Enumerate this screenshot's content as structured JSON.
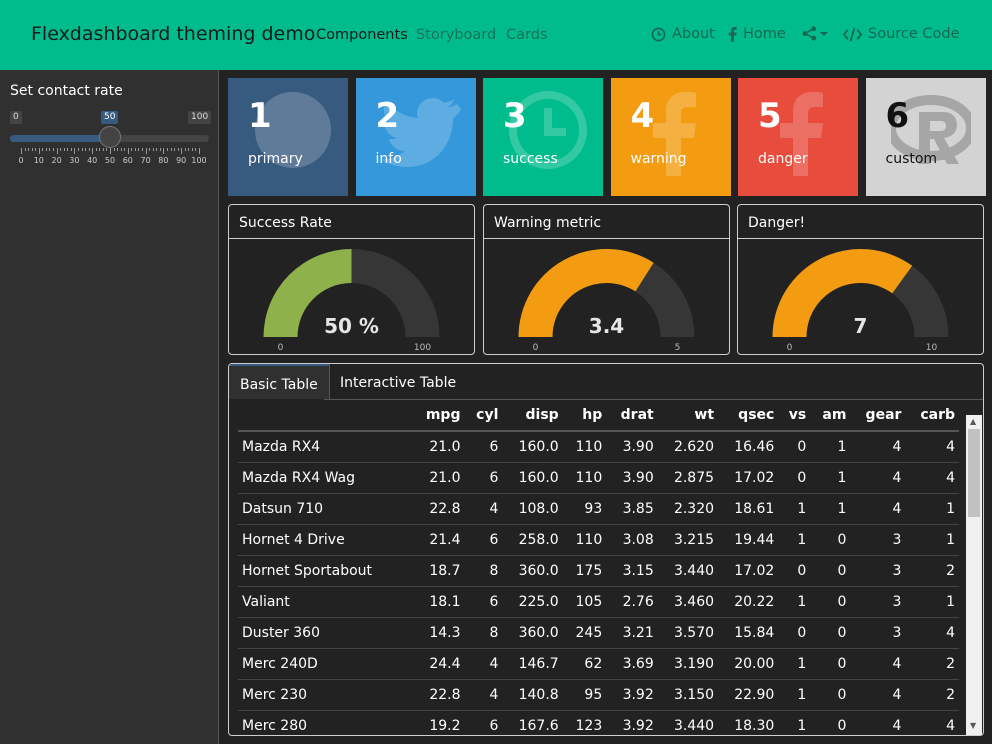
{
  "navbar": {
    "brand": "Flexdashboard theming demo",
    "links": [
      "Components",
      "Storyboard",
      "Cards"
    ],
    "right": {
      "about": "About",
      "home": "Home",
      "source": "Source Code"
    },
    "bg_color": "#00bc8c"
  },
  "sidebar": {
    "label": "Set contact rate",
    "slider": {
      "min": "0",
      "max": "100",
      "value": "50",
      "ticks": [
        "0",
        "10",
        "20",
        "30",
        "40",
        "50",
        "60",
        "70",
        "80",
        "90",
        "100"
      ]
    }
  },
  "value_boxes": [
    {
      "value": "1",
      "caption": "primary",
      "color": "#375a7f",
      "icon": "github-icon"
    },
    {
      "value": "2",
      "caption": "info",
      "color": "#3498db",
      "icon": "twitter-icon"
    },
    {
      "value": "3",
      "caption": "success",
      "color": "#00bc8c",
      "icon": "clock-icon"
    },
    {
      "value": "4",
      "caption": "warning",
      "color": "#f39c12",
      "icon": "facebook-icon"
    },
    {
      "value": "5",
      "caption": "danger",
      "color": "#e74c3c",
      "icon": "facebook-icon"
    },
    {
      "value": "6",
      "caption": "custom",
      "color": "#d3d3d3",
      "icon": "r-logo-icon"
    }
  ],
  "gauges": [
    {
      "title": "Success Rate",
      "value": 50,
      "min": 0,
      "max": 100,
      "display": "50 %",
      "min_label": "0",
      "max_label": "100",
      "color": "#8fb14b"
    },
    {
      "title": "Warning metric",
      "value": 3.4,
      "min": 0,
      "max": 5,
      "display": "3.4",
      "min_label": "0",
      "max_label": "5",
      "color": "#f39c12"
    },
    {
      "title": "Danger!",
      "value": 7,
      "min": 0,
      "max": 10,
      "display": "7",
      "min_label": "0",
      "max_label": "10",
      "color": "#f39c12"
    }
  ],
  "tabs": [
    "Basic Table",
    "Interactive Table"
  ],
  "table": {
    "columns": [
      "",
      "mpg",
      "cyl",
      "disp",
      "hp",
      "drat",
      "wt",
      "qsec",
      "vs",
      "am",
      "gear",
      "carb"
    ],
    "rows": [
      [
        "Mazda RX4",
        "21.0",
        "6",
        "160.0",
        "110",
        "3.90",
        "2.620",
        "16.46",
        "0",
        "1",
        "4",
        "4"
      ],
      [
        "Mazda RX4 Wag",
        "21.0",
        "6",
        "160.0",
        "110",
        "3.90",
        "2.875",
        "17.02",
        "0",
        "1",
        "4",
        "4"
      ],
      [
        "Datsun 710",
        "22.8",
        "4",
        "108.0",
        "93",
        "3.85",
        "2.320",
        "18.61",
        "1",
        "1",
        "4",
        "1"
      ],
      [
        "Hornet 4 Drive",
        "21.4",
        "6",
        "258.0",
        "110",
        "3.08",
        "3.215",
        "19.44",
        "1",
        "0",
        "3",
        "1"
      ],
      [
        "Hornet Sportabout",
        "18.7",
        "8",
        "360.0",
        "175",
        "3.15",
        "3.440",
        "17.02",
        "0",
        "0",
        "3",
        "2"
      ],
      [
        "Valiant",
        "18.1",
        "6",
        "225.0",
        "105",
        "2.76",
        "3.460",
        "20.22",
        "1",
        "0",
        "3",
        "1"
      ],
      [
        "Duster 360",
        "14.3",
        "8",
        "360.0",
        "245",
        "3.21",
        "3.570",
        "15.84",
        "0",
        "0",
        "3",
        "4"
      ],
      [
        "Merc 240D",
        "24.4",
        "4",
        "146.7",
        "62",
        "3.69",
        "3.190",
        "20.00",
        "1",
        "0",
        "4",
        "2"
      ],
      [
        "Merc 230",
        "22.8",
        "4",
        "140.8",
        "95",
        "3.92",
        "3.150",
        "22.90",
        "1",
        "0",
        "4",
        "2"
      ],
      [
        "Merc 280",
        "19.2",
        "6",
        "167.6",
        "123",
        "3.92",
        "3.440",
        "18.30",
        "1",
        "0",
        "4",
        "4"
      ]
    ]
  }
}
